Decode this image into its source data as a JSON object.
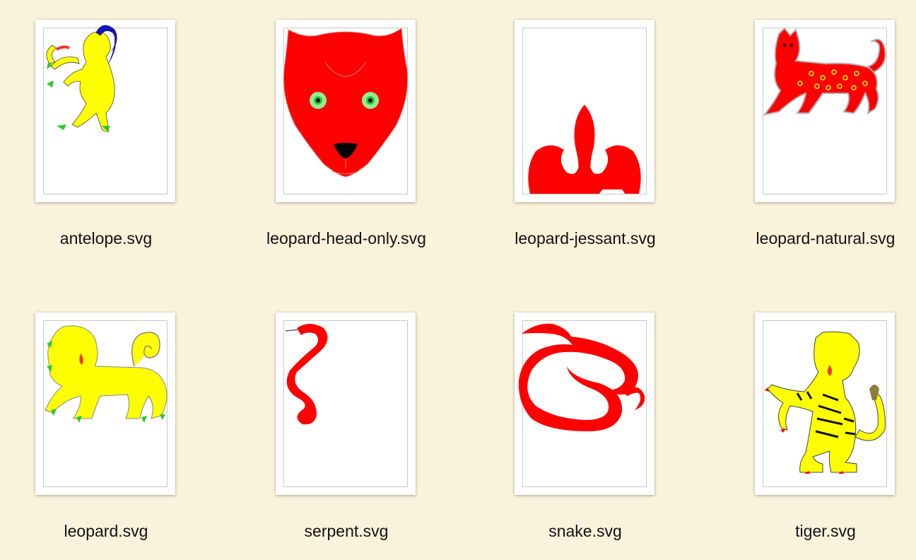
{
  "files": [
    {
      "name": "antelope.svg",
      "icon": "antelope-icon"
    },
    {
      "name": "leopard-head-only.svg",
      "icon": "leopard-head-icon"
    },
    {
      "name": "leopard-jessant.svg",
      "icon": "fleur-de-lis-icon"
    },
    {
      "name": "leopard-natural.svg",
      "icon": "leopard-natural-icon"
    },
    {
      "name": "leopard.svg",
      "icon": "leopard-icon"
    },
    {
      "name": "serpent.svg",
      "icon": "serpent-icon"
    },
    {
      "name": "snake.svg",
      "icon": "snake-icon"
    },
    {
      "name": "tiger.svg",
      "icon": "tiger-icon"
    }
  ],
  "colors": {
    "background": "#fbf2dc",
    "red": "#ff0000",
    "yellow": "#ffff00",
    "blue": "#1010c8",
    "green": "#2ec82e"
  }
}
